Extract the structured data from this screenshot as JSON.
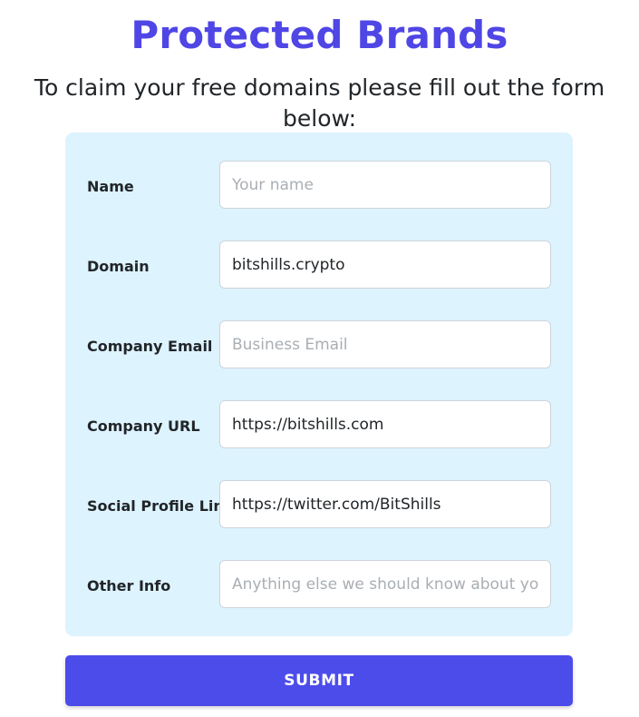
{
  "header": {
    "title": "Protected Brands",
    "subtitle": "To claim your free domains please fill out the form below:",
    "title_color": "#4f46e5",
    "subtitle_color": "#212529"
  },
  "form": {
    "panel_background": "#ddf3fe",
    "fields": [
      {
        "label": "Name",
        "value": "",
        "placeholder": "Your name",
        "name": "name"
      },
      {
        "label": "Domain",
        "value": "bitshills.crypto",
        "placeholder": "",
        "name": "domain"
      },
      {
        "label": "Company Email",
        "value": "",
        "placeholder": "Business Email",
        "name": "company-email"
      },
      {
        "label": "Company URL",
        "value": "https://bitshills.com",
        "placeholder": "",
        "name": "company-url"
      },
      {
        "label": "Social Profile Link",
        "value": "https://twitter.com/BitShills",
        "placeholder": "",
        "name": "social-profile-link"
      },
      {
        "label": "Other Info",
        "value": "",
        "placeholder": "Anything else we should know about your brand",
        "name": "other-info"
      }
    ]
  },
  "submit": {
    "label": "SUBMIT",
    "color": "#4c4ceb",
    "text_color": "#ffffff"
  }
}
